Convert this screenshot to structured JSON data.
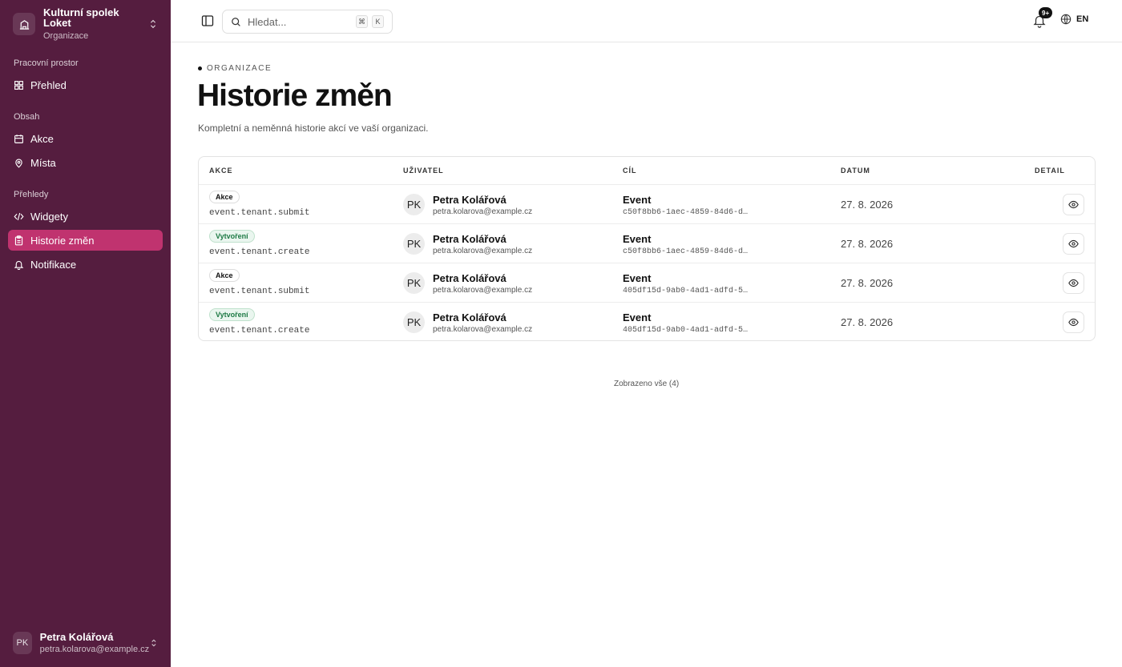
{
  "org": {
    "name": "Kulturní spolek Loket",
    "subtitle": "Organizace"
  },
  "nav": {
    "groups": [
      "Pracovní prostor",
      "Obsah",
      "Přehledy"
    ],
    "items": [
      {
        "label": "Přehled",
        "icon": "grid-icon"
      },
      {
        "label": "Akce",
        "icon": "calendar-icon"
      },
      {
        "label": "Místa",
        "icon": "map-pin-icon"
      },
      {
        "label": "Widgety",
        "icon": "code-icon"
      },
      {
        "label": "Historie změn",
        "icon": "clipboard-icon",
        "active": true
      },
      {
        "label": "Notifikace",
        "icon": "bell-icon"
      }
    ]
  },
  "user": {
    "initials": "PK",
    "name": "Petra Kolářová",
    "email": "petra.kolarova@example.cz"
  },
  "topbar": {
    "search_placeholder": "Hledat...",
    "kbd1": "⌘",
    "kbd2": "K",
    "notif_badge": "9+",
    "lang": "EN"
  },
  "page": {
    "eyebrow": "ORGANIZACE",
    "title": "Historie změn",
    "description": "Kompletní a neměnná historie akcí ve vaší organizaci."
  },
  "table": {
    "headers": [
      "AKCE",
      "UŽIVATEL",
      "CÍL",
      "DATUM",
      "DETAIL"
    ],
    "rows": [
      {
        "badge": "Akce",
        "badge_kind": "action",
        "code": "event.tenant.submit",
        "initials": "PK",
        "user": "Petra Kolářová",
        "email": "petra.kolarova@example.cz",
        "target": "Event",
        "target_id": "c50f8bb6-1aec-4859-84d6-d…",
        "date": "27. 8. 2026"
      },
      {
        "badge": "Vytvoření",
        "badge_kind": "create",
        "code": "event.tenant.create",
        "initials": "PK",
        "user": "Petra Kolářová",
        "email": "petra.kolarova@example.cz",
        "target": "Event",
        "target_id": "c50f8bb6-1aec-4859-84d6-d…",
        "date": "27. 8. 2026"
      },
      {
        "badge": "Akce",
        "badge_kind": "action",
        "code": "event.tenant.submit",
        "initials": "PK",
        "user": "Petra Kolářová",
        "email": "petra.kolarova@example.cz",
        "target": "Event",
        "target_id": "405df15d-9ab0-4ad1-adfd-5…",
        "date": "27. 8. 2026"
      },
      {
        "badge": "Vytvoření",
        "badge_kind": "create",
        "code": "event.tenant.create",
        "initials": "PK",
        "user": "Petra Kolářová",
        "email": "petra.kolarova@example.cz",
        "target": "Event",
        "target_id": "405df15d-9ab0-4ad1-adfd-5…",
        "date": "27. 8. 2026"
      }
    ]
  },
  "footer": {
    "count_text": "Zobrazeno vše (4)"
  },
  "colors": {
    "sidebar": "#551d3f",
    "active": "#c0336f",
    "create_badge": "#1e7a45"
  }
}
